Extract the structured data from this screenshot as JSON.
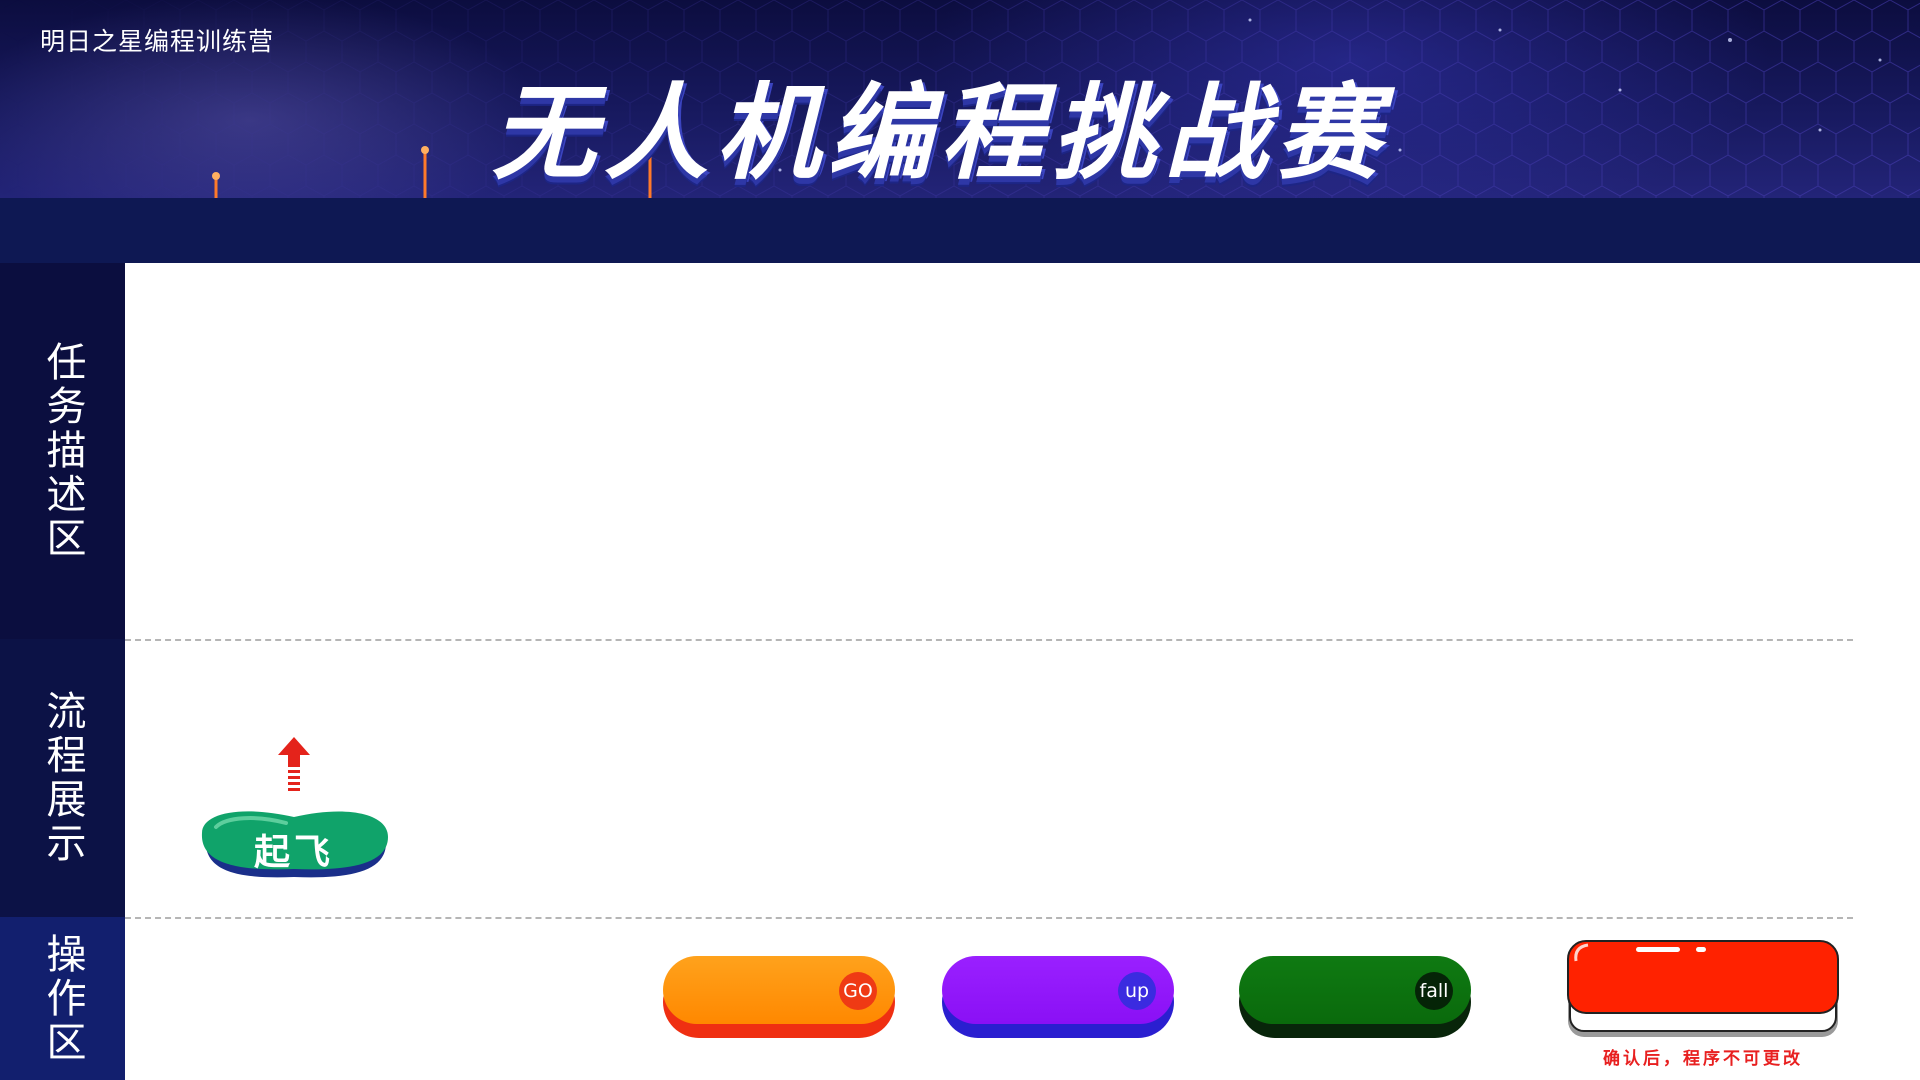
{
  "header": {
    "org_name": "明日之星编程训练营",
    "title": "无人机编程挑战赛"
  },
  "sections": {
    "task_label": "任务描述区",
    "flow_label": "流程展示",
    "ops_label": "操作区"
  },
  "flow": {
    "blocks": [
      {
        "label": "起飞",
        "color": "#12a86a",
        "arrow_icon": "up-arrow-icon"
      }
    ]
  },
  "operations": {
    "buttons": [
      {
        "badge": "GO",
        "color": "#ff8f00"
      },
      {
        "badge": "up",
        "color": "#8e15fa"
      },
      {
        "badge": "fall",
        "color": "#0b700e"
      }
    ],
    "confirm": {
      "color": "#ff2200",
      "note": "确认后，程序不可更改"
    }
  }
}
